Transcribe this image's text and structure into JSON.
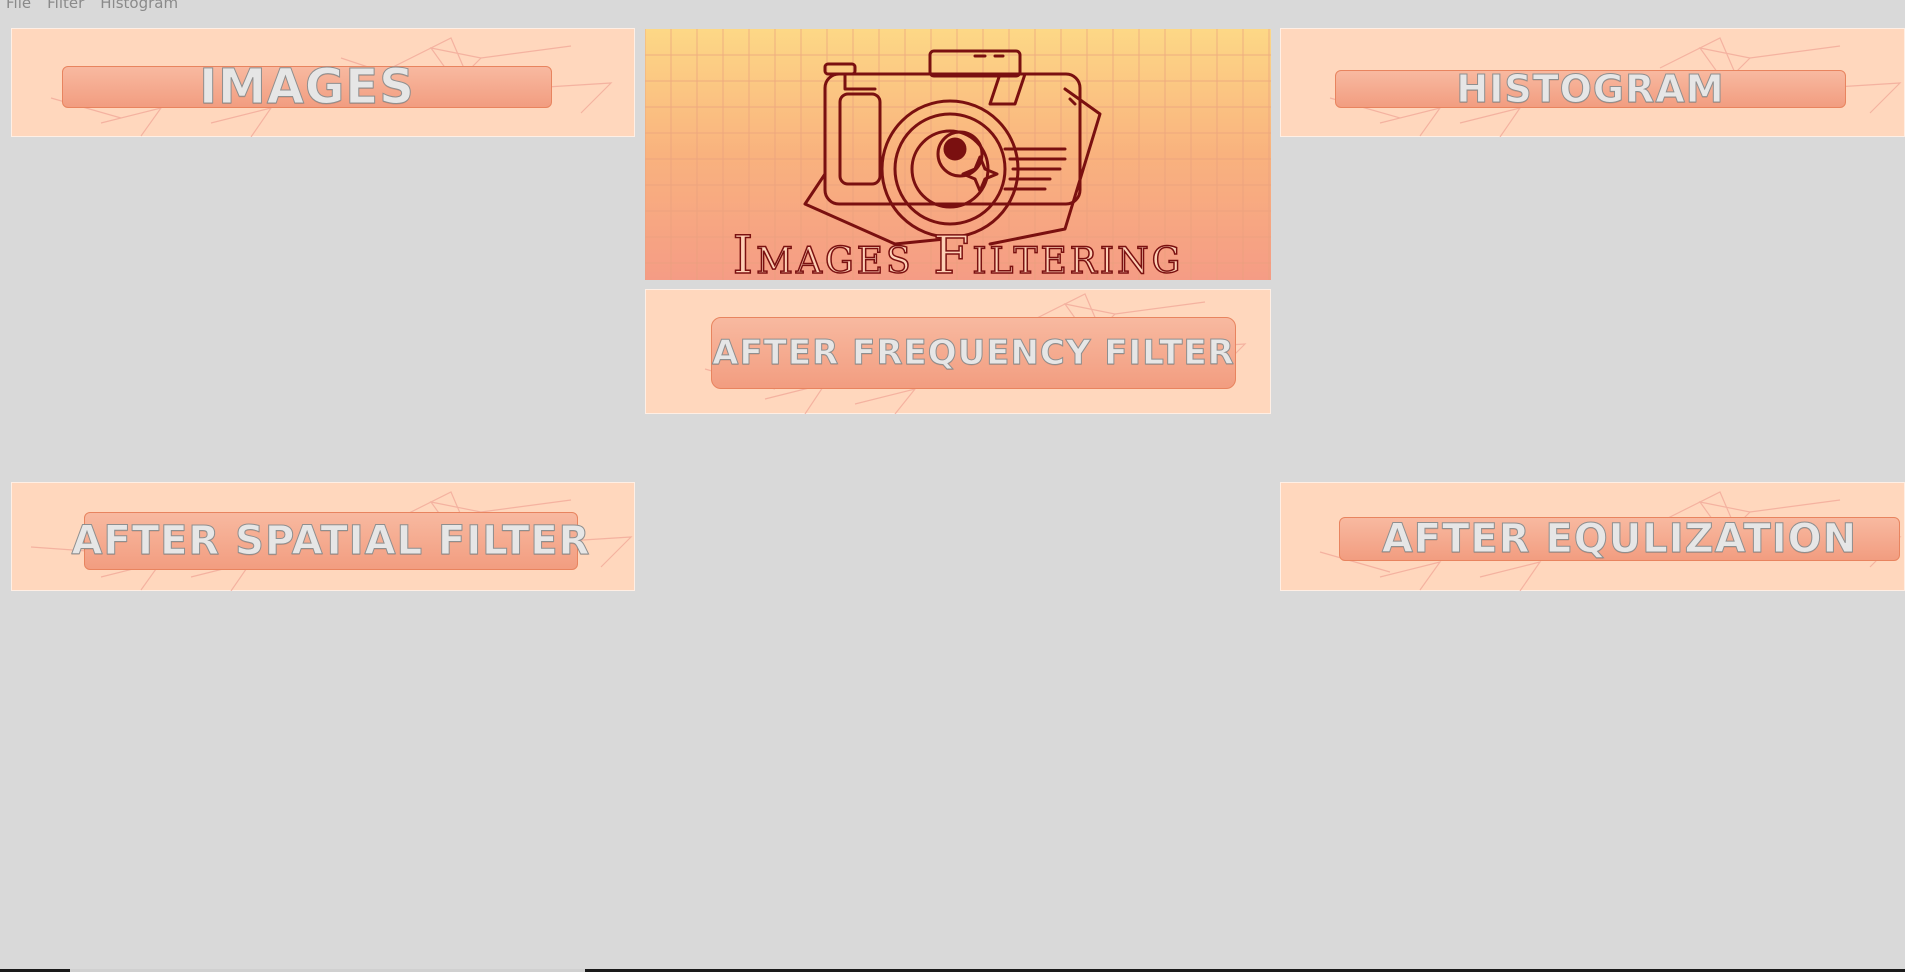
{
  "menu": {
    "file": "File",
    "filter": "Filter",
    "histogram": "Histogram"
  },
  "logo": {
    "title": "Images Filtering"
  },
  "panels": {
    "images": "IMAGES",
    "histogram": "HISTOGRAM",
    "after_frequency": "AFTER FREQUENCY FILTER",
    "after_spatial": "AFTER SPATIAL FILTER",
    "after_equalization": "AFTER EQULIZATION"
  },
  "colors": {
    "background": "#d9d9d9",
    "banner": "#ffd7bd",
    "pill": "#f4a88c",
    "logo_stroke": "#7a1010"
  },
  "icons": [
    "camera-icon"
  ]
}
